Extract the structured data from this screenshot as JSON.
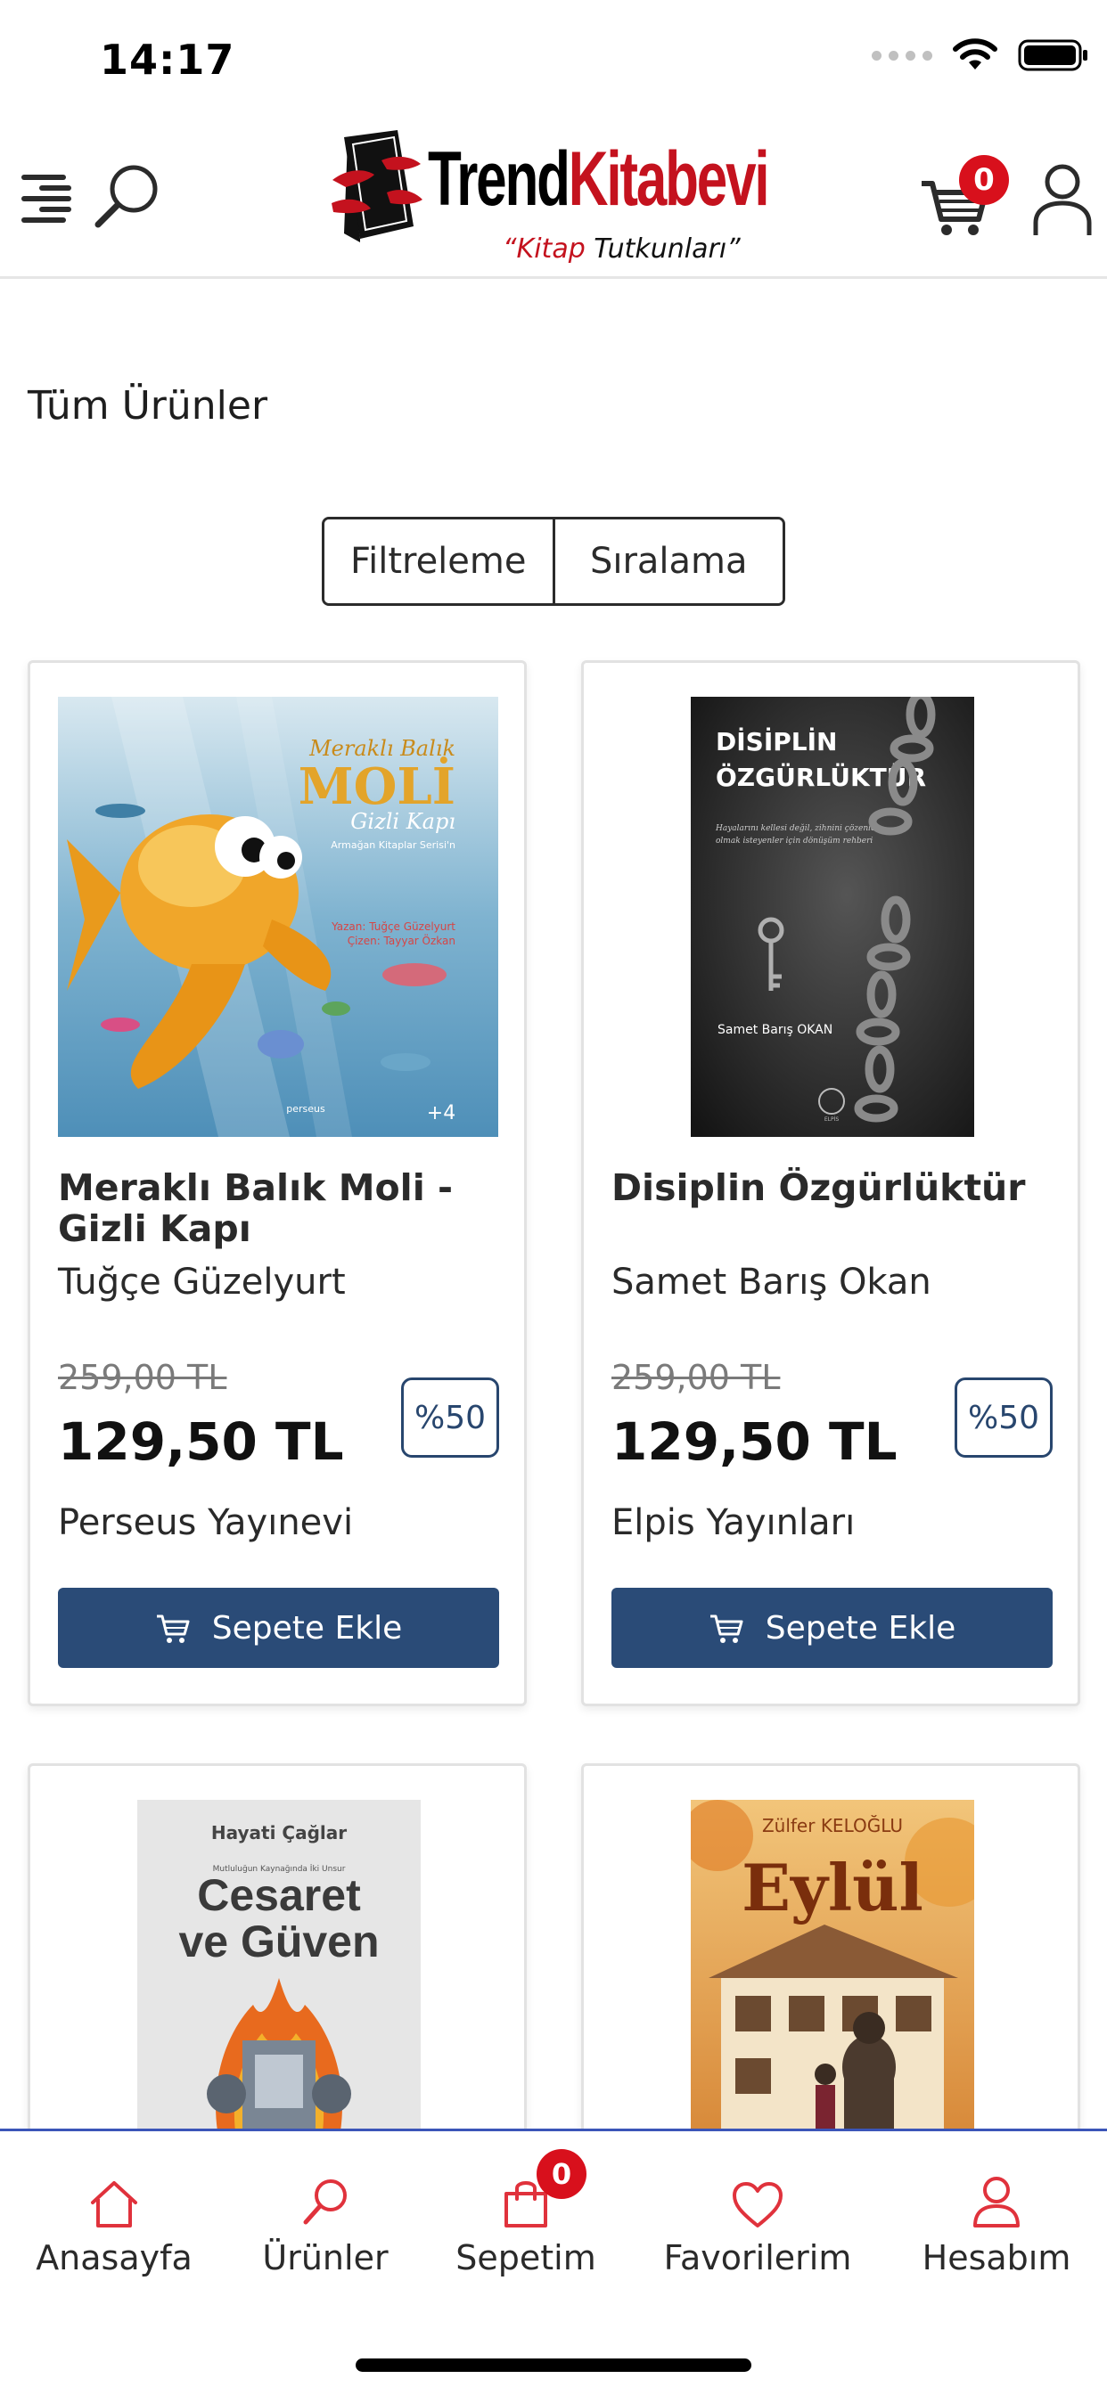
{
  "status": {
    "time": "14:17"
  },
  "header": {
    "logo_trend": "Trend",
    "logo_kitabevi": "Kitabevi",
    "tagline_quote_open": "“",
    "tagline_kitap": "Kitap",
    "tagline_rest": " Tutkunları”",
    "cart_count": "0"
  },
  "page": {
    "title": "Tüm Ürünler"
  },
  "controls": {
    "filter_label": "Filtreleme",
    "sort_label": "Sıralama"
  },
  "products": [
    {
      "title": "Meraklı Balık Moli - Gizli Kapı",
      "author": "Tuğçe Güzelyurt",
      "old_price": "259,00 TL",
      "price": "129,50 TL",
      "discount": "%50",
      "publisher": "Perseus Yayınevi",
      "button": "Sepete Ekle",
      "cover": {
        "series": "Meraklı Balık",
        "name": "MOLİ",
        "subtitle": "Gizli Kapı",
        "series_line": "Armağan Kitaplar Serisi'n",
        "credits_1": "Yazan: Tuğçe Güzelyurt",
        "credits_2": "Çizen: Tayyar Özkan",
        "publisher_mark": "perseus",
        "age": "+4"
      }
    },
    {
      "title": "Disiplin Özgürlüktür",
      "author": "Samet Barış Okan",
      "old_price": "259,00 TL",
      "price": "129,50 TL",
      "discount": "%50",
      "publisher": "Elpis Yayınları",
      "button": "Sepete Ekle",
      "cover": {
        "line1": "DİSİPLİN",
        "line2": "ÖZGÜRLÜKTÜR",
        "blurb_1": "Hayalarını kellesi değil, zihnini çözenler",
        "blurb_2": "olmak isteyenler için dönüşüm rehberi",
        "author": "Samet Barış OKAN",
        "publisher_mark": "ELPİS"
      }
    },
    {
      "cover": {
        "author": "Hayati Çağlar",
        "small": "Mutluluğun Kaynağında İki Unsur",
        "line1": "Cesaret",
        "line2": "ve Güven"
      }
    },
    {
      "cover": {
        "author": "Zülfer KELOĞLU",
        "title": "Eylül"
      }
    }
  ],
  "tabbar": {
    "home": "Anasayfa",
    "products": "Ürünler",
    "cart": "Sepetim",
    "cart_count": "0",
    "favorites": "Favorilerim",
    "account": "Hesabım"
  },
  "colors": {
    "brand_red": "#c4121e",
    "primary_button": "#2a4b77",
    "tab_icon": "#e0323c",
    "tab_border": "#3b55b8"
  }
}
